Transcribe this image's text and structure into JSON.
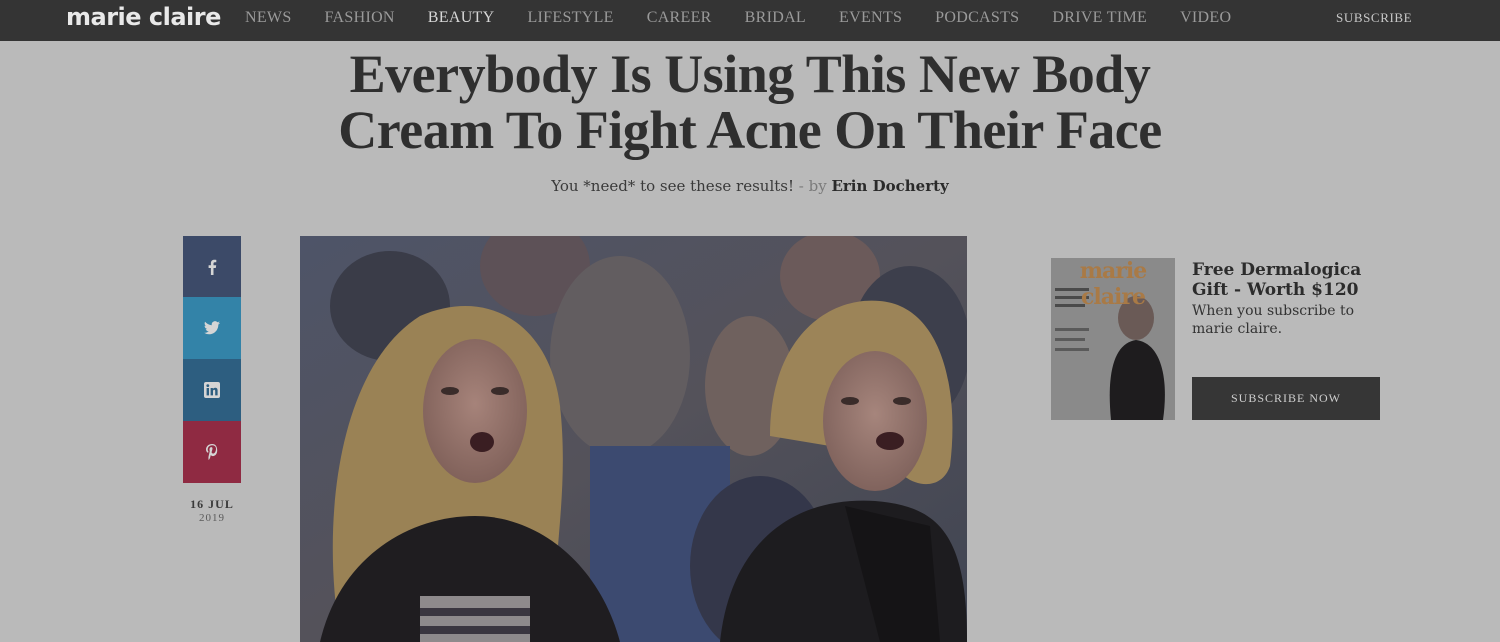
{
  "header": {
    "logo": "marie claire",
    "nav": [
      "NEWS",
      "FASHION",
      "BEAUTY",
      "LIFESTYLE",
      "CAREER",
      "BRIDAL",
      "EVENTS",
      "PODCASTS",
      "DRIVE TIME",
      "VIDEO"
    ],
    "active_nav": "BEAUTY",
    "subscribe": "SUBSCRIBE"
  },
  "article": {
    "headline_line1": "Everybody Is Using This New Body",
    "headline_line2": "Cream To Fight Acne On Their Face",
    "dek": "You *need* to see these results!",
    "by": " - by ",
    "author": "Erin Docherty",
    "date_day": "16 JUL",
    "date_year": "2019"
  },
  "share": {
    "icons": [
      "facebook-icon",
      "twitter-icon",
      "linkedin-icon",
      "pinterest-icon"
    ],
    "colors": {
      "facebook": "#3c4a68",
      "twitter": "#3383a8",
      "linkedin": "#2d5e80",
      "pinterest": "#8f2a42"
    }
  },
  "promo": {
    "cover_masthead": "marie claire",
    "title": "Free Dermalogica Gift - Worth $120",
    "text": "When you subscribe to marie claire.",
    "button": "SUBSCRIBE NOW"
  },
  "colors": {
    "topbar": "#343434",
    "page_overlay": "#bababa"
  }
}
